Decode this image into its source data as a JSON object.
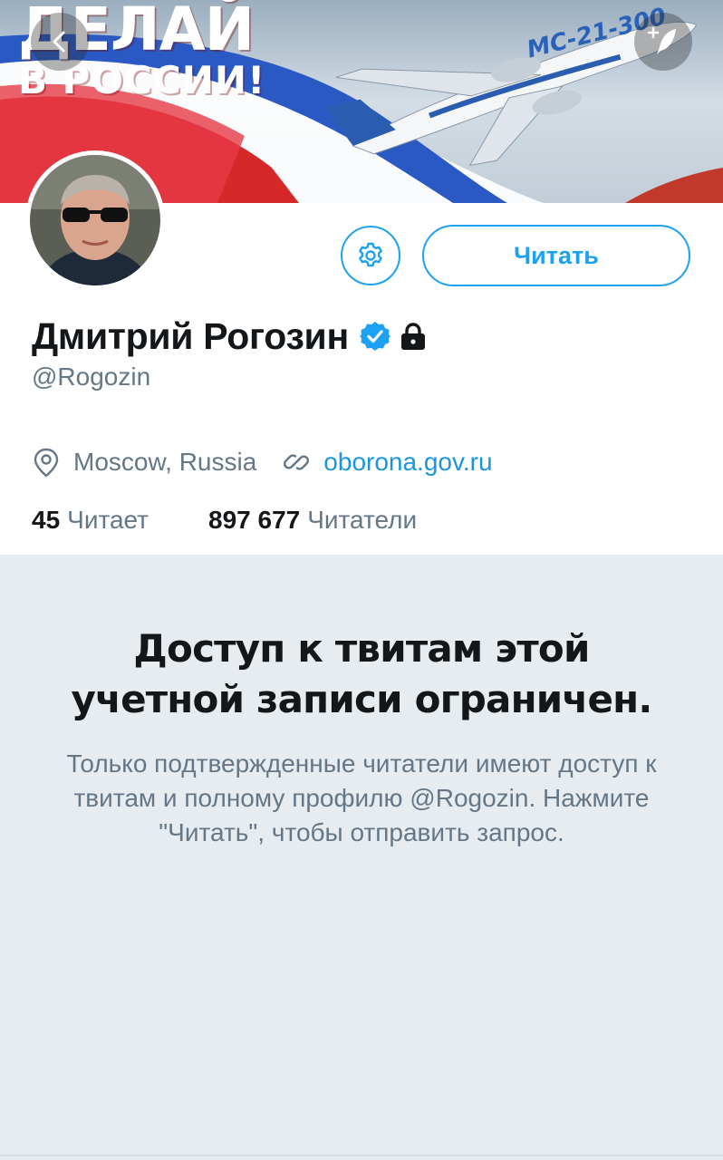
{
  "banner": {
    "slogan_line1": "ДЕЛАЙ",
    "slogan_line2": "В РОССИИ!",
    "aircraft_label": "МС-21-300"
  },
  "nav": {
    "back_icon": "chevron-left-icon",
    "compose_icon": "compose-feather-icon"
  },
  "profile": {
    "name": "Дмитрий Рогозин",
    "handle": "@Rogozin",
    "location": "Moscow, Russia",
    "website": "oborona.gov.ru",
    "follow_label": "Читать",
    "following_count": "45",
    "following_label": "Читает",
    "followers_count": "897 677",
    "followers_label": "Читатели",
    "verified": true,
    "protected": true
  },
  "protected_notice": {
    "title": "Доступ к твитам этой учетной записи ограничен.",
    "body": "Только подтвержденные читатели имеют доступ к твитам и полному профилю @Rogozin. Нажмите \"Читать\", чтобы отправить запрос."
  },
  "colors": {
    "accent": "#1da1f2",
    "link": "#1b95e0",
    "muted": "#657786",
    "background": "#e6ecf0"
  }
}
